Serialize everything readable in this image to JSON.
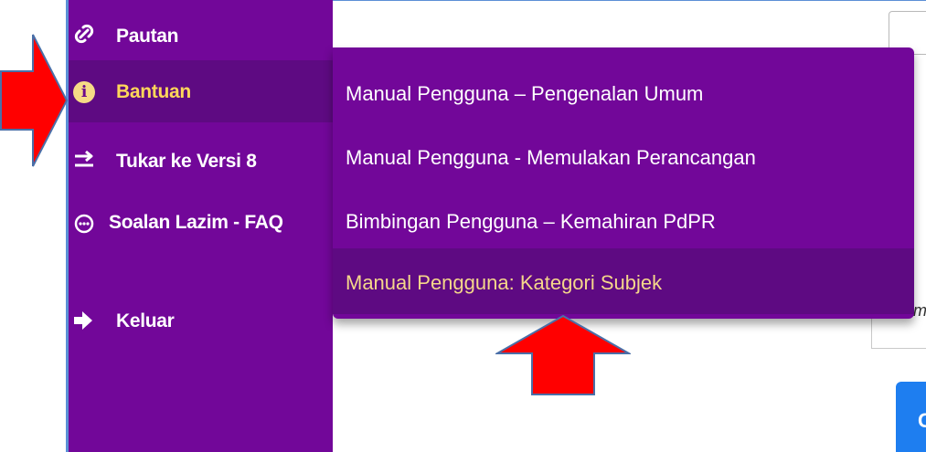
{
  "sidebar": {
    "items": [
      {
        "label": "Pautan",
        "icon": "link-icon"
      },
      {
        "label": "Bantuan",
        "icon": "info-icon",
        "active": true
      },
      {
        "label": "Tukar ke Versi 8",
        "icon": "switch-arrows-icon"
      },
      {
        "label": "Soalan Lazim - FAQ",
        "icon": "faq-icon"
      },
      {
        "label": "Keluar",
        "icon": "logout-icon"
      }
    ]
  },
  "dropdown": {
    "items": [
      {
        "label": "Manual Pengguna – Pengenalan Umum"
      },
      {
        "label": "Manual Pengguna - Memulakan Perancangan"
      },
      {
        "label": "Bimbingan Pengguna – Kemahiran PdPR"
      },
      {
        "label": "Manual Pengguna: Kategori Subjek",
        "highlighted": true
      }
    ]
  },
  "main": {
    "partial_text": "m",
    "button_partial_label": "C"
  },
  "colors": {
    "sidebar_bg": "#720799",
    "active_item_bg": "#5e0a82",
    "active_label": "#ffd75a",
    "annotation_arrow": "#ff0000",
    "button_blue": "#1e7ef0"
  }
}
